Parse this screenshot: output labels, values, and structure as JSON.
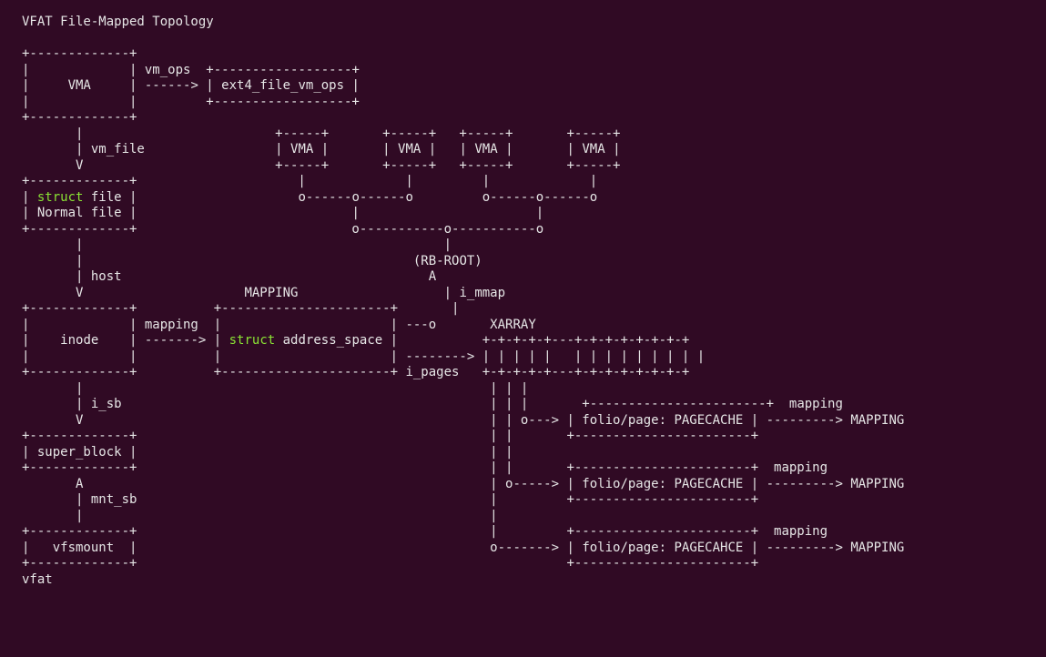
{
  "title": "VFAT File-Mapped Topology",
  "colors": {
    "background": "#300a24",
    "text": "#e6e6e6",
    "keyword": "#8ae234"
  },
  "labels": {
    "vma": "VMA",
    "vm_ops": "vm_ops",
    "ext4_ops": "ext4_file_vm_ops",
    "vm_file": "vm_file",
    "struct": "struct",
    "file": "file",
    "normal_file": "Normal file",
    "host": "host",
    "mapping_header": "MAPPING",
    "inode": "inode",
    "mapping": "mapping",
    "address_space": "address_space",
    "i_mmap": "i_mmap",
    "rb_root": "(RB-ROOT)",
    "xarray": "XARRAY",
    "i_pages": "i_pages",
    "i_sb": "i_sb",
    "super_block": "super_block",
    "mnt_sb": "mnt_sb",
    "vfsmount": "vfsmount",
    "vfat": "vfat",
    "folio1": "folio/page: PAGECACHE",
    "folio2": "folio/page: PAGECACHE",
    "folio3": "folio/page: PAGECAHCE",
    "to_mapping": "MAPPING"
  }
}
